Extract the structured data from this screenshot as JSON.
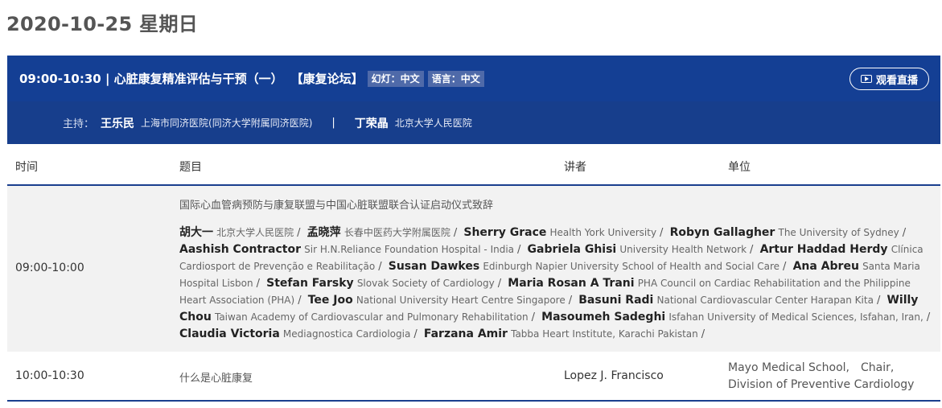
{
  "date_heading": "2020-10-25 星期日",
  "session": {
    "time_title": "09:00-10:30 | 心脏康复精准评估与干预（一）",
    "forum": "【康复论坛】",
    "slides_tag": "幻灯：中文",
    "language_tag": "语言：中文",
    "live_button": "观看直播",
    "host_label": "主持：",
    "hosts": [
      {
        "name": "王乐民",
        "org": "上海市同济医院(同济大学附属同济医院)"
      },
      {
        "name": "丁荣晶",
        "org": "北京大学人民医院"
      }
    ],
    "host_separator": "|"
  },
  "columns": {
    "time": "时间",
    "topic": "题目",
    "speaker": "讲者",
    "unit": "单位"
  },
  "rows": [
    {
      "time": "09:00-10:00",
      "topic": "国际心血管病预防与康复联盟与中国心脏联盟联合认证启动仪式致辞",
      "speakers": [
        {
          "name": "胡大一",
          "org": "北京大学人民医院"
        },
        {
          "name": "孟晓萍",
          "org": "长春中医药大学附属医院"
        },
        {
          "name": "Sherry Grace",
          "org": "Health York University"
        },
        {
          "name": "Robyn Gallagher",
          "org": "The University of Sydney"
        },
        {
          "name": "Aashish Contractor",
          "org": "Sir H.N.Reliance Foundation Hospital - India"
        },
        {
          "name": "Gabriela Ghisi",
          "org": "University Health Network"
        },
        {
          "name": "Artur Haddad Herdy",
          "org": "Clínica Cardiosport de Prevenção e Reabilitação"
        },
        {
          "name": "Susan Dawkes",
          "org": "Edinburgh Napier University School of Health and Social Care"
        },
        {
          "name": "Ana Abreu",
          "org": "Santa Maria Hospital Lisbon"
        },
        {
          "name": "Stefan Farsky",
          "org": "Slovak Society of Cardiology"
        },
        {
          "name": "Maria Rosan A Trani",
          "org": "PHA Council on Cardiac Rehabilitation and the Philippine Heart Association (PHA)"
        },
        {
          "name": "Tee Joo",
          "org": "National University Heart Centre Singapore"
        },
        {
          "name": "Basuni Radi",
          "org": "National Cardiovascular Center Harapan Kita"
        },
        {
          "name": "Willy Chou",
          "org": "Taiwan Academy of Cardiovascular and Pulmonary Rehabilitation"
        },
        {
          "name": "Masoumeh Sadeghi",
          "org": "Isfahan University of Medical Sciences, Isfahan, Iran,"
        },
        {
          "name": "Claudia Victoria",
          "org": "Mediagnostica Cardiologia"
        },
        {
          "name": "Farzana Amir",
          "org": "Tabba Heart Institute, Karachi Pakistan"
        }
      ],
      "separator": "/"
    },
    {
      "time": "10:00-10:30",
      "topic": "什么是心脏康复",
      "speaker": "Lopez J. Francisco",
      "unit": "Mayo Medical School,　Chair, Division of Preventive Cardiology"
    }
  ]
}
